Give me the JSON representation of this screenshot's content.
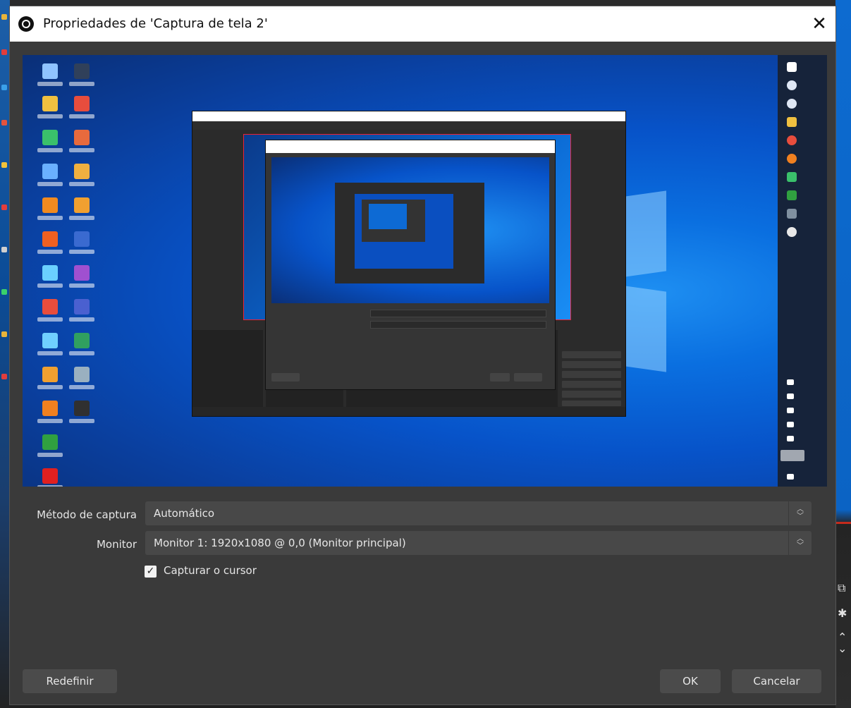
{
  "window": {
    "title": "Propriedades de 'Captura de tela 2'",
    "close_glyph": "✕",
    "icon": "obs-logo-icon"
  },
  "preview": {
    "description_icon": "desktop-capture-preview"
  },
  "properties": {
    "capture_method": {
      "label": "Método de captura",
      "value": "Automático"
    },
    "monitor": {
      "label": "Monitor",
      "value": "Monitor 1: 1920x1080 @ 0,0 (Monitor principal)"
    },
    "capture_cursor": {
      "label": "Capturar o cursor",
      "checked": true
    }
  },
  "buttons": {
    "reset": "Redefinir",
    "ok": "OK",
    "cancel": "Cancelar"
  },
  "colors": {
    "dialog_bg": "#3a3a3a",
    "titlebar_bg": "#ffffff",
    "combo_bg": "#484848",
    "button_bg": "#4b4b4b",
    "desktop_blue": "#0753c9"
  }
}
